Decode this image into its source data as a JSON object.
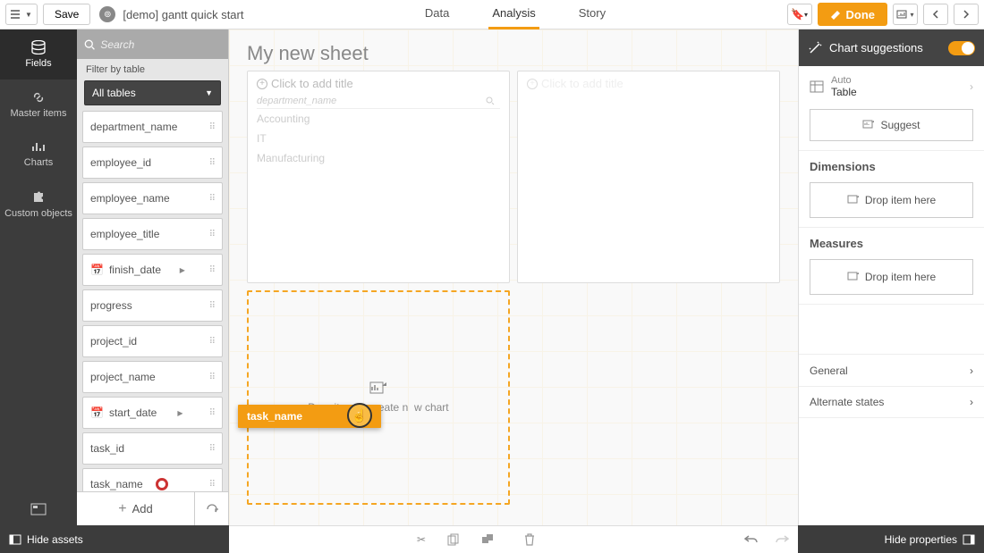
{
  "toolbar": {
    "save_label": "Save",
    "app_title": "[demo] gantt quick start",
    "tabs": {
      "data": "Data",
      "analysis": "Analysis",
      "story": "Story"
    },
    "done_label": "Done"
  },
  "dark_sidebar": {
    "fields": "Fields",
    "master": "Master items",
    "charts": "Charts",
    "custom": "Custom objects"
  },
  "fields_panel": {
    "search_placeholder": "Search",
    "filter_label": "Filter by table",
    "table_select": "All tables",
    "fields": [
      "department_name",
      "employee_id",
      "employee_name",
      "employee_title",
      "finish_date",
      "progress",
      "project_id",
      "project_name",
      "start_date",
      "task_id",
      "task_name"
    ],
    "add_label": "Add"
  },
  "canvas": {
    "sheet_title": "My new sheet",
    "add_title": "Click to add title",
    "chart1": {
      "header": "department_name",
      "rows": [
        "Accounting",
        "IT",
        "Manufacturing"
      ]
    },
    "drop_label": "Drop item to create new chart",
    "drag_item": "task_name"
  },
  "right_panel": {
    "header": "Chart suggestions",
    "auto": "Auto",
    "auto_sub": "Table",
    "suggest": "Suggest",
    "dimensions": "Dimensions",
    "measures": "Measures",
    "drop_here": "Drop item here",
    "general": "General",
    "alt_states": "Alternate states"
  },
  "bottom": {
    "hide_assets": "Hide assets",
    "hide_props": "Hide properties"
  }
}
